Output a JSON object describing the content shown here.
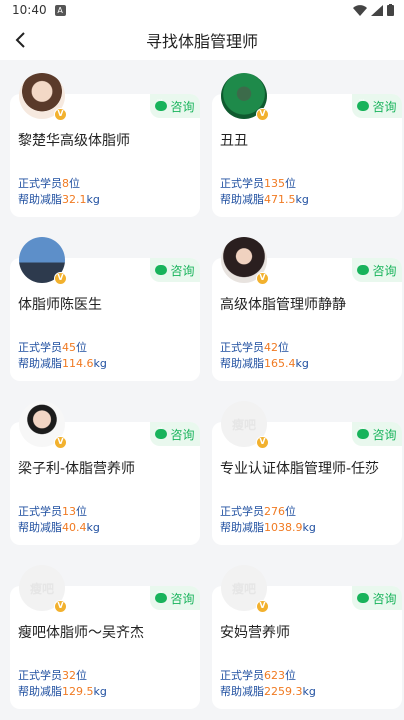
{
  "status_bar": {
    "time": "10:40",
    "icon_a": "A"
  },
  "header": {
    "title": "寻找体脂管理师"
  },
  "consult_label": "咨询",
  "stat_labels": {
    "students_prefix": "正式学员",
    "students_suffix": "位",
    "loss_prefix": "帮助减脂",
    "loss_suffix": "kg"
  },
  "managers": [
    {
      "name": "黎楚华高级体脂师",
      "students": "8",
      "loss": "32.1"
    },
    {
      "name": "丑丑",
      "students": "135",
      "loss": "471.5"
    },
    {
      "name": "体脂师陈医生",
      "students": "45",
      "loss": "114.6"
    },
    {
      "name": "高级体脂管理师静静",
      "students": "42",
      "loss": "165.4"
    },
    {
      "name": "梁子利-体脂营养师",
      "students": "13",
      "loss": "40.4"
    },
    {
      "name": "专业认证体脂管理师-任莎",
      "students": "276",
      "loss": "1038.9"
    },
    {
      "name": "瘦吧体脂师～吴齐杰",
      "students": "32",
      "loss": "129.5"
    },
    {
      "name": "安妈营养师",
      "students": "623",
      "loss": "2259.3"
    }
  ],
  "placeholder_logo_text": "瘦吧",
  "verified_badge": "V"
}
